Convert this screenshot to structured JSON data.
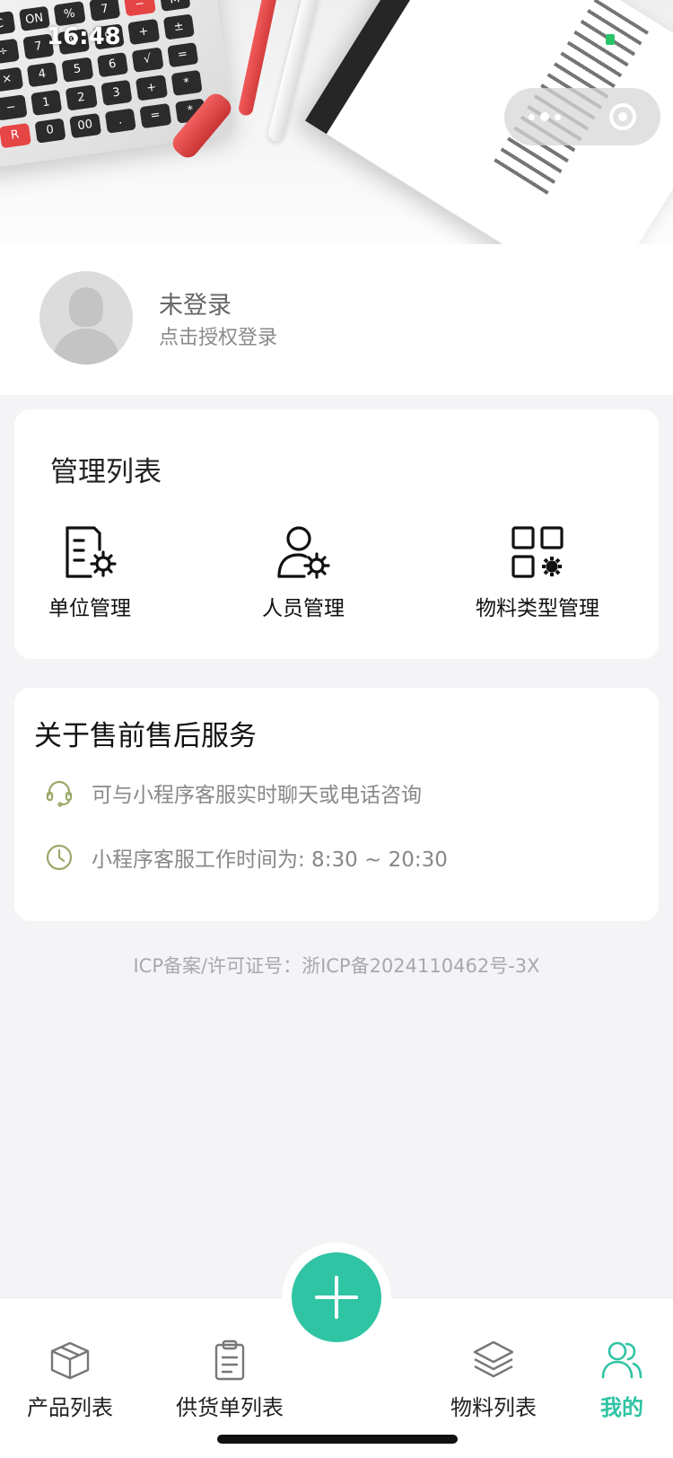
{
  "status_bar": {
    "time": "16:48"
  },
  "user": {
    "name": "未登录",
    "hint": "点击授权登录"
  },
  "manage": {
    "title": "管理列表",
    "items": [
      {
        "label": "单位管理",
        "icon": "document-gear-icon"
      },
      {
        "label": "人员管理",
        "icon": "user-gear-icon"
      },
      {
        "label": "物料类型管理",
        "icon": "grid-gear-icon"
      }
    ]
  },
  "service": {
    "title": "关于售前售后服务",
    "rows": [
      {
        "text": "可与小程序客服实时聊天或电话咨询",
        "icon": "headset-icon"
      },
      {
        "text": "小程序客服工作时间为: 8:30 ~ 20:30",
        "icon": "clock-icon"
      }
    ]
  },
  "footer": {
    "icp": "ICP备案/许可证号：浙ICP备2024110462号-3X"
  },
  "tabs": [
    {
      "label": "产品列表",
      "icon": "box-icon"
    },
    {
      "label": "供货单列表",
      "icon": "clipboard-icon"
    },
    {
      "label": "物料列表",
      "icon": "layers-icon"
    },
    {
      "label": "我的",
      "icon": "users-icon",
      "active": true
    }
  ],
  "colors": {
    "accent": "#2fc4a4",
    "service_icon": "#9aa86a",
    "background": "#f4f3f6"
  }
}
